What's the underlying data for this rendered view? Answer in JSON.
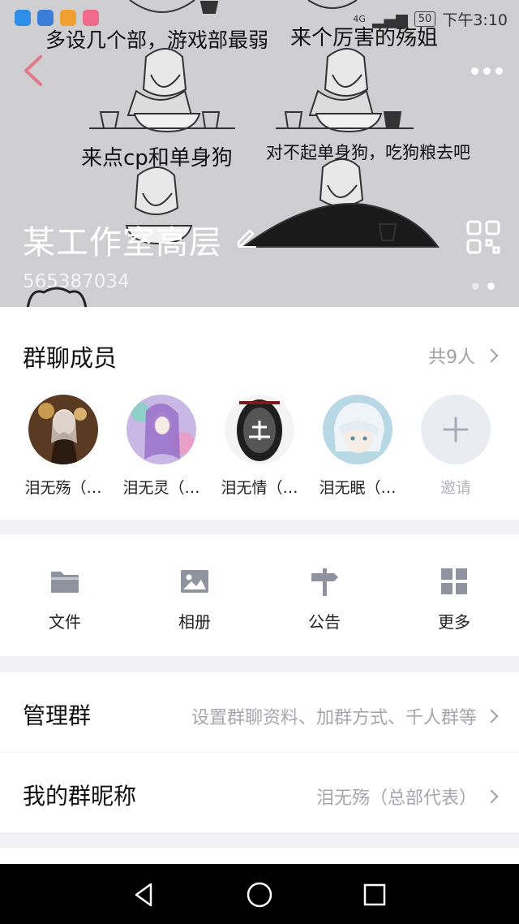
{
  "status_bar": {
    "battery": "50",
    "time": "下午3:10",
    "net": "4G",
    "app_colors": [
      "#2f8ee8",
      "#3b7dd8",
      "#f0a030",
      "#f06a8c"
    ]
  },
  "header": {
    "captions": [
      "多设几个部，游戏部最弱",
      "来个厉害的殇姐",
      "来点cp和单身狗",
      "对不起单身狗，吃狗粮去吧"
    ],
    "group_name": "某工作室高层",
    "group_id": "565387034"
  },
  "members": {
    "title": "群聊成员",
    "count": "共9人",
    "list": [
      {
        "name": "泪无殇（…",
        "color": "#7a5a3a"
      },
      {
        "name": "泪无灵（…",
        "color": "#b8a0d8"
      },
      {
        "name": "泪无情（…",
        "color": "#2a2a2a"
      },
      {
        "name": "泪无眠（…",
        "color": "#9fc6dc"
      }
    ],
    "invite_label": "邀请"
  },
  "tools": [
    {
      "icon": "folder-icon",
      "label": "文件"
    },
    {
      "icon": "image-icon",
      "label": "相册"
    },
    {
      "icon": "signpost-icon",
      "label": "公告"
    },
    {
      "icon": "grid-icon",
      "label": "更多"
    }
  ],
  "manage": {
    "title": "管理群",
    "value": "设置群聊资料、加群方式、千人群等"
  },
  "nickname": {
    "title": "我的群昵称",
    "value": "泪无殇（总部代表）"
  },
  "colors": {
    "accent": "#e07a8a",
    "icon_gray": "#8e939f",
    "secondary_text": "#a0a0a6"
  }
}
